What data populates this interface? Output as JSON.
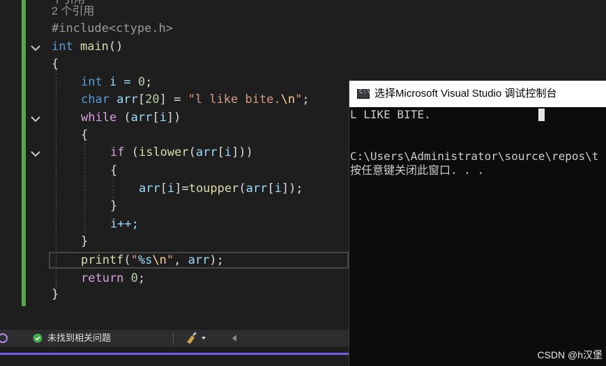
{
  "editor": {
    "partial_top": "个引用",
    "refs": "2 个引用",
    "include": "#include<ctype.h>",
    "lines": {
      "main_kw": "int",
      "main_fn": "main",
      "main_tail": "()",
      "open1": "{",
      "decl_i_kw": "int",
      "decl_i_rest": " i = ",
      "decl_i_num": "0",
      "decl_i_end": ";",
      "decl_arr_kw": "char",
      "decl_arr_var": " arr",
      "decl_arr_b1": "[",
      "decl_arr_num": "20",
      "decl_arr_b2": "] = ",
      "decl_arr_str1": "\"l like bite.",
      "decl_arr_esc": "\\n",
      "decl_arr_str2": "\"",
      "decl_arr_end": ";",
      "while_kw": "while",
      "while_rest1": " (",
      "while_var": "arr",
      "while_rest2": "[",
      "while_i": "i",
      "while_rest3": "])",
      "open2": "{",
      "if_kw": "if",
      "if_rest1": " (",
      "if_fn": "islower",
      "if_rest2": "(",
      "if_var": "arr",
      "if_rest3": "[",
      "if_i": "i",
      "if_rest4": "]))",
      "open3": "{",
      "asg_var": "arr",
      "asg_b1": "[",
      "asg_i": "i",
      "asg_b2": "]=",
      "asg_fn": "toupper",
      "asg_p1": "(",
      "asg_var2": "arr",
      "asg_b3": "[",
      "asg_i2": "i",
      "asg_end": "]);",
      "close3": "}",
      "inc": "i++;",
      "close2": "}",
      "printf_fn": "printf",
      "printf_p1": "(",
      "printf_str1": "\"",
      "printf_fmt": "%s",
      "printf_esc": "\\n",
      "printf_str2": "\"",
      "printf_p2": ", ",
      "printf_var": "arr",
      "printf_end": ");",
      "ret_kw": "return",
      "ret_sp": " ",
      "ret_num": "0",
      "ret_end": ";",
      "close1": "}"
    }
  },
  "statusbar": {
    "issues": "未找到相关问题"
  },
  "console": {
    "title": "选择Microsoft Visual Studio 调试控制台",
    "icon_text": "C:\\",
    "output1": "L LIKE BITE.",
    "path": "C:\\Users\\Administrator\\source\\repos\\t",
    "press_key": "按任意键关闭此窗口. . ."
  },
  "watermark": "CSDN @h汉堡"
}
